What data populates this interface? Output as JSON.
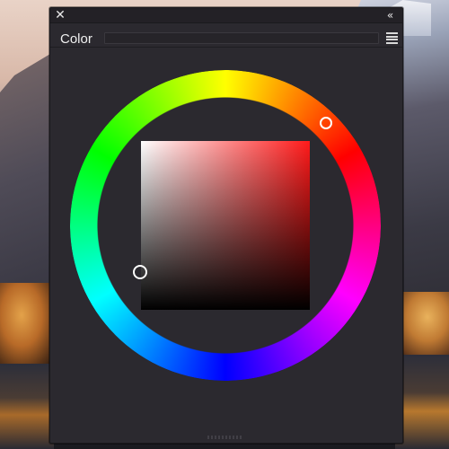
{
  "panel": {
    "title": "Color",
    "close_icon": "close-icon",
    "collapse_icon": "double-chevron-left-icon",
    "menu_icon": "hamburger-menu-icon"
  },
  "color_picker": {
    "type": "hue-ring-with-saturation-value-square",
    "selected_hue_color": "#ff1a1a",
    "sv_base_color": "#ff1a1a",
    "colors": {
      "panel_background": "#2b292f",
      "handle_outline": "#ffffff"
    }
  }
}
